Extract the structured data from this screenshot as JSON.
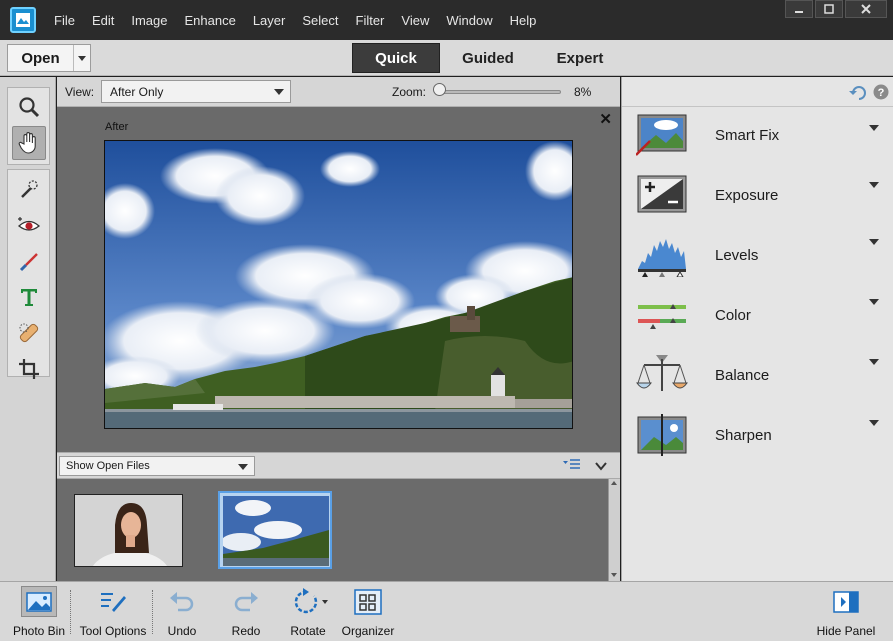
{
  "menubar": {
    "items": [
      "File",
      "Edit",
      "Image",
      "Enhance",
      "Layer",
      "Select",
      "Filter",
      "View",
      "Window",
      "Help"
    ]
  },
  "modebar": {
    "open_label": "Open",
    "modes": [
      "Quick",
      "Guided",
      "Expert"
    ],
    "active_mode": "Quick"
  },
  "options": {
    "view_label": "View:",
    "view_value": "After Only",
    "zoom_label": "Zoom:",
    "zoom_value": "8%"
  },
  "canvas": {
    "after_label": "After",
    "close_glyph": "✕"
  },
  "bin": {
    "show_label": "Show Open Files"
  },
  "adjustments": [
    {
      "label": "Smart Fix"
    },
    {
      "label": "Exposure"
    },
    {
      "label": "Levels"
    },
    {
      "label": "Color"
    },
    {
      "label": "Balance"
    },
    {
      "label": "Sharpen"
    }
  ],
  "bottom": {
    "photo_bin": "Photo Bin",
    "tool_options": "Tool Options",
    "undo": "Undo",
    "redo": "Redo",
    "rotate": "Rotate",
    "organizer": "Organizer",
    "hide_panel": "Hide Panel"
  },
  "colors": {
    "accent": "#1a8fd0",
    "active_mode_bg": "#3c3c3c"
  }
}
